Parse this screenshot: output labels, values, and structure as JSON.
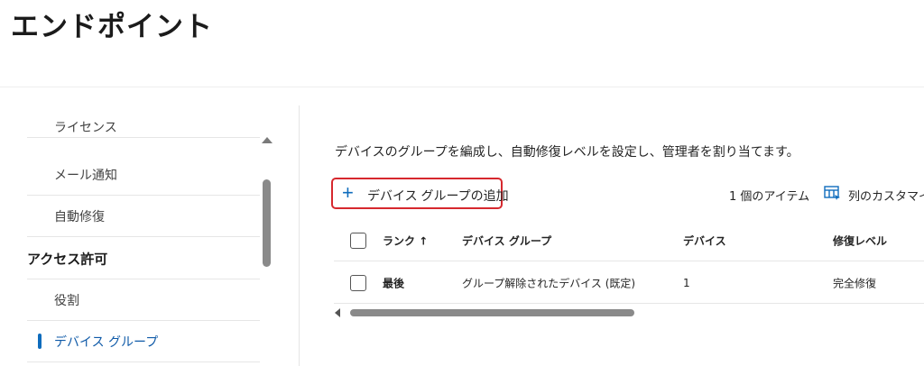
{
  "page": {
    "title": "エンドポイント"
  },
  "sidebar": {
    "items": [
      {
        "label": "ライセンス"
      },
      {
        "label": "メール通知"
      },
      {
        "label": "自動修復"
      },
      {
        "label": "アクセス許可"
      },
      {
        "label": "役割"
      },
      {
        "label": "デバイス グループ"
      }
    ]
  },
  "main": {
    "description": "デバイスのグループを編成し、自動修復レベルを設定し、管理者を割り当てます。",
    "add_button": "デバイス グループの追加",
    "item_count": "1 個のアイテム",
    "customize_columns": "列のカスタマイズ",
    "columns": {
      "rank": "ランク ↑",
      "group": "デバイス グループ",
      "devices": "デバイス",
      "level": "修復レベル"
    },
    "rows": [
      {
        "rank": "最後",
        "group": "グループ解除されたデバイス (既定)",
        "devices": "1",
        "level": "完全修復"
      }
    ]
  },
  "colors": {
    "accent": "#0f6cbd",
    "highlight_border": "#d6282e"
  }
}
